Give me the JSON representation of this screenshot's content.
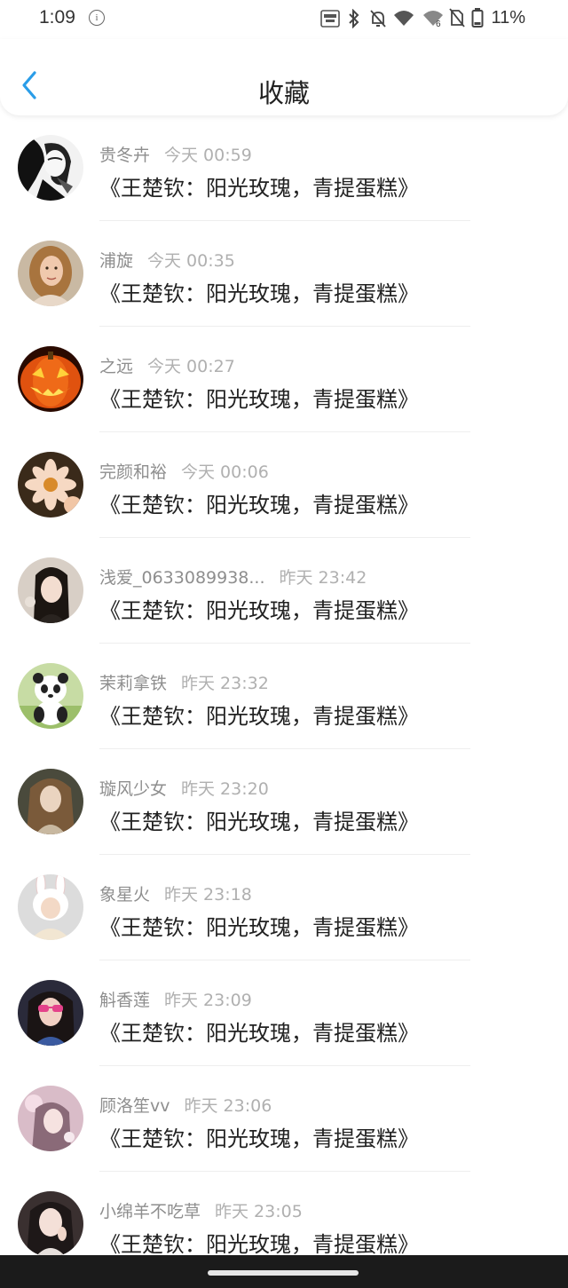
{
  "status_bar": {
    "time": "1:09",
    "battery": "11%",
    "icons": [
      "info-icon",
      "auto-hz-icon",
      "bluetooth-icon",
      "notifications-off-icon",
      "wifi-icon",
      "wifi-6-icon",
      "no-sim-icon",
      "battery-icon"
    ]
  },
  "header": {
    "title": "收藏",
    "back_icon": "chevron-left-icon",
    "accent_color": "#2a9de8"
  },
  "items": [
    {
      "name": "贵冬卉",
      "time": "今天 00:59",
      "message": "《王楚钦：阳光玫瑰，青提蛋糕》",
      "avatar": "sketch-portrait"
    },
    {
      "name": "浦旋",
      "time": "今天 00:35",
      "message": "《王楚钦：阳光玫瑰，青提蛋糕》",
      "avatar": "woman-portrait"
    },
    {
      "name": "之远",
      "time": "今天 00:27",
      "message": "《王楚钦：阳光玫瑰，青提蛋糕》",
      "avatar": "pumpkin-lantern"
    },
    {
      "name": "完颜和裕",
      "time": "今天 00:06",
      "message": "《王楚钦：阳光玫瑰，青提蛋糕》",
      "avatar": "flowers"
    },
    {
      "name": "浅爱_0633089938...",
      "time": "昨天 23:42",
      "message": "《王楚钦：阳光玫瑰，青提蛋糕》",
      "avatar": "girl-portrait"
    },
    {
      "name": "茉莉拿铁",
      "time": "昨天 23:32",
      "message": "《王楚钦：阳光玫瑰，青提蛋糕》",
      "avatar": "panda"
    },
    {
      "name": "璇风少女",
      "time": "昨天 23:20",
      "message": "《王楚钦：阳光玫瑰，青提蛋糕》",
      "avatar": "girl-portrait"
    },
    {
      "name": "象星火",
      "time": "昨天 23:18",
      "message": "《王楚钦：阳光玫瑰，青提蛋糕》",
      "avatar": "bunny-hat"
    },
    {
      "name": "斛香莲",
      "time": "昨天 23:09",
      "message": "《王楚钦：阳光玫瑰，青提蛋糕》",
      "avatar": "sunglasses-girl"
    },
    {
      "name": "顾洛笙vv",
      "time": "昨天 23:06",
      "message": "《王楚钦：阳光玫瑰，青提蛋糕》",
      "avatar": "pink-portrait"
    },
    {
      "name": "小绵羊不吃草",
      "time": "昨天 23:05",
      "message": "《王楚钦：阳光玫瑰，青提蛋糕》",
      "avatar": "girl-portrait"
    }
  ]
}
